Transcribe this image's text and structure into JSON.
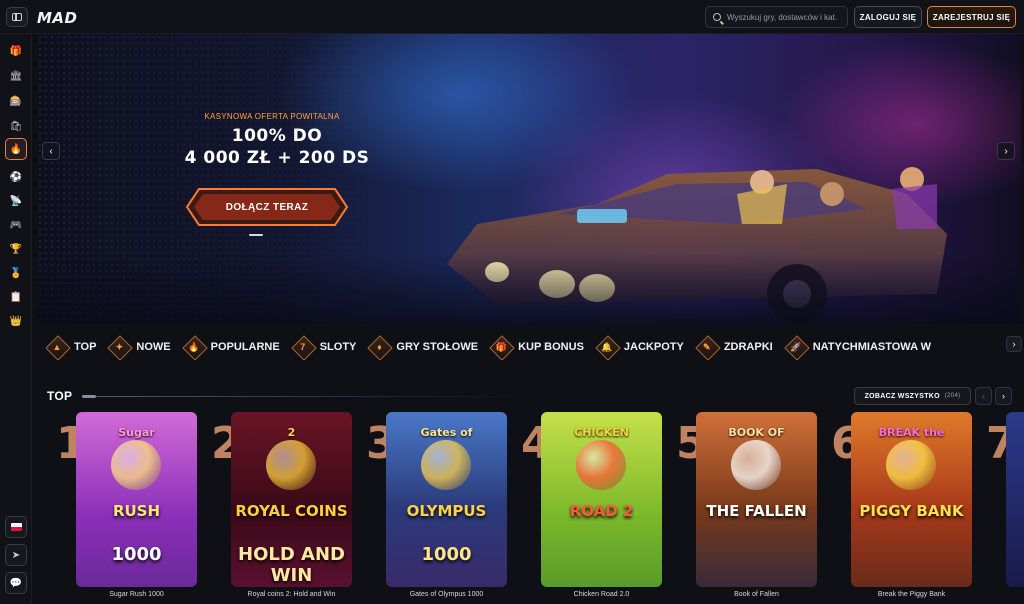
{
  "header": {
    "logo": "MAD",
    "search_placeholder": "Wyszukuj gry, dostawców i kat...",
    "login_label": "ZALOGUJ SIĘ",
    "register_label": "ZAREJESTRUJ SIĘ"
  },
  "sidebar": {
    "items": [
      {
        "icon": "gift-icon",
        "glyph": "🎁"
      },
      {
        "icon": "casino-icon",
        "glyph": "🏛"
      },
      {
        "icon": "live-casino-icon",
        "glyph": "🎰"
      },
      {
        "icon": "shop-icon",
        "glyph": "🛍"
      },
      {
        "icon": "fire-icon",
        "glyph": "🔥",
        "active": true
      },
      {
        "icon": "sports-ball-icon",
        "glyph": "⚽"
      },
      {
        "icon": "live-broadcast-icon",
        "glyph": "📡"
      },
      {
        "icon": "esports-controller-icon",
        "glyph": "🎮"
      },
      {
        "icon": "trophy-icon",
        "glyph": "🏆"
      },
      {
        "icon": "medal-icon",
        "glyph": "🏅"
      },
      {
        "icon": "clipboard-icon",
        "glyph": "📋"
      },
      {
        "icon": "crown-icon",
        "glyph": "👑"
      }
    ],
    "bottom": [
      {
        "icon": "poland-flag-icon"
      },
      {
        "icon": "telegram-icon",
        "glyph": "➤"
      },
      {
        "icon": "chat-icon",
        "glyph": "💬"
      }
    ]
  },
  "hero": {
    "subtitle": "KASYNOWA OFERTA POWITALNA",
    "title_line1": "100% DO",
    "title_line2": "4 000 ZŁ + 200 DS",
    "cta_label": "DOŁĄCZ TERAZ",
    "accent": "#ff7b2e"
  },
  "categories": [
    {
      "label": "TOP",
      "glyph": "▲"
    },
    {
      "label": "NOWE",
      "glyph": "✦"
    },
    {
      "label": "POPULARNE",
      "glyph": "🔥"
    },
    {
      "label": "SLOTY",
      "glyph": "7"
    },
    {
      "label": "GRY STOŁOWE",
      "glyph": "♦"
    },
    {
      "label": "KUP BONUS",
      "glyph": "🎁"
    },
    {
      "label": "JACKPOTY",
      "glyph": "🔔"
    },
    {
      "label": "ZDRAPKI",
      "glyph": "✎"
    },
    {
      "label": "NATYCHMIASTOWA W",
      "glyph": "🚀"
    }
  ],
  "top_section": {
    "title": "TOP",
    "see_all_label": "ZOBACZ WSZYSTKO",
    "see_all_count": "(204)"
  },
  "games": [
    {
      "rank": "1",
      "name": "Sugar Rush 1000",
      "art_top": "Sugar",
      "art_mid": "RUSH",
      "art_bottom": "1000"
    },
    {
      "rank": "2",
      "name": "Royal coins 2: Hold and Win",
      "art_top": "2",
      "art_mid": "ROYAL COINS",
      "art_bottom": "HOLD AND WIN"
    },
    {
      "rank": "3",
      "name": "Gates of Olympus 1000",
      "art_top": "Gates of",
      "art_mid": "OLYMPUS",
      "art_bottom": "1000"
    },
    {
      "rank": "4",
      "name": "Chicken Road 2.0",
      "art_top": "CHICKEN",
      "art_mid": "ROAD 2",
      "art_bottom": ""
    },
    {
      "rank": "5",
      "name": "Book of Fallen",
      "art_top": "BOOK OF",
      "art_mid": "THE FALLEN",
      "art_bottom": ""
    },
    {
      "rank": "6",
      "name": "Break the Piggy Bank",
      "art_top": "BREAK the",
      "art_mid": "PIGGY BANK",
      "art_bottom": ""
    },
    {
      "rank": "7",
      "name": "",
      "art_top": "",
      "art_mid": "",
      "art_bottom": ""
    }
  ]
}
